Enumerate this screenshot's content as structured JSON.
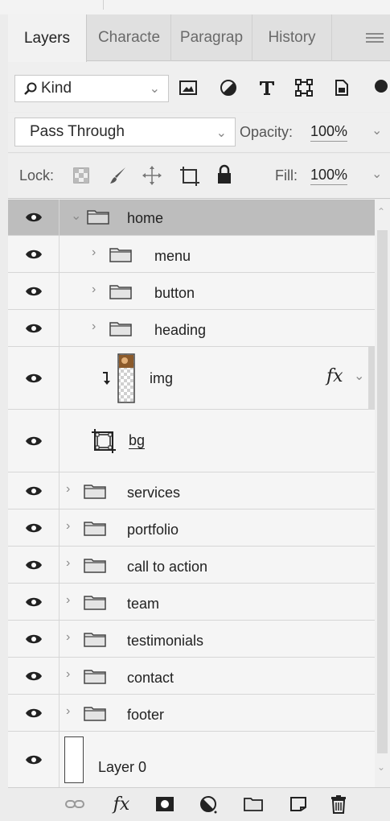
{
  "tabs": [
    {
      "label": "Layers",
      "active": true
    },
    {
      "label": "Characte",
      "active": false
    },
    {
      "label": "Paragrap",
      "active": false
    },
    {
      "label": "History",
      "active": false
    }
  ],
  "filter": {
    "kind_label": "Kind"
  },
  "blend": {
    "mode": "Pass Through",
    "opacity_label": "Opacity:",
    "opacity_value": "100%"
  },
  "lock": {
    "label": "Lock:",
    "fill_label": "Fill:",
    "fill_value": "100%"
  },
  "layers": [
    {
      "name": "home"
    },
    {
      "name": "menu"
    },
    {
      "name": "button"
    },
    {
      "name": "heading"
    },
    {
      "name": "img",
      "fx": "fx"
    },
    {
      "name": "bg"
    },
    {
      "name": "services"
    },
    {
      "name": "portfolio"
    },
    {
      "name": "call to action"
    },
    {
      "name": "team"
    },
    {
      "name": "testimonials"
    },
    {
      "name": "contact"
    },
    {
      "name": "footer"
    },
    {
      "name": "Layer 0"
    }
  ],
  "bottom": {
    "fx_label": "fx"
  },
  "colors": {
    "selected_row": "#bdbdbd",
    "panel": "#f5f5f5",
    "accent_thumb": "#8b5a2b"
  }
}
